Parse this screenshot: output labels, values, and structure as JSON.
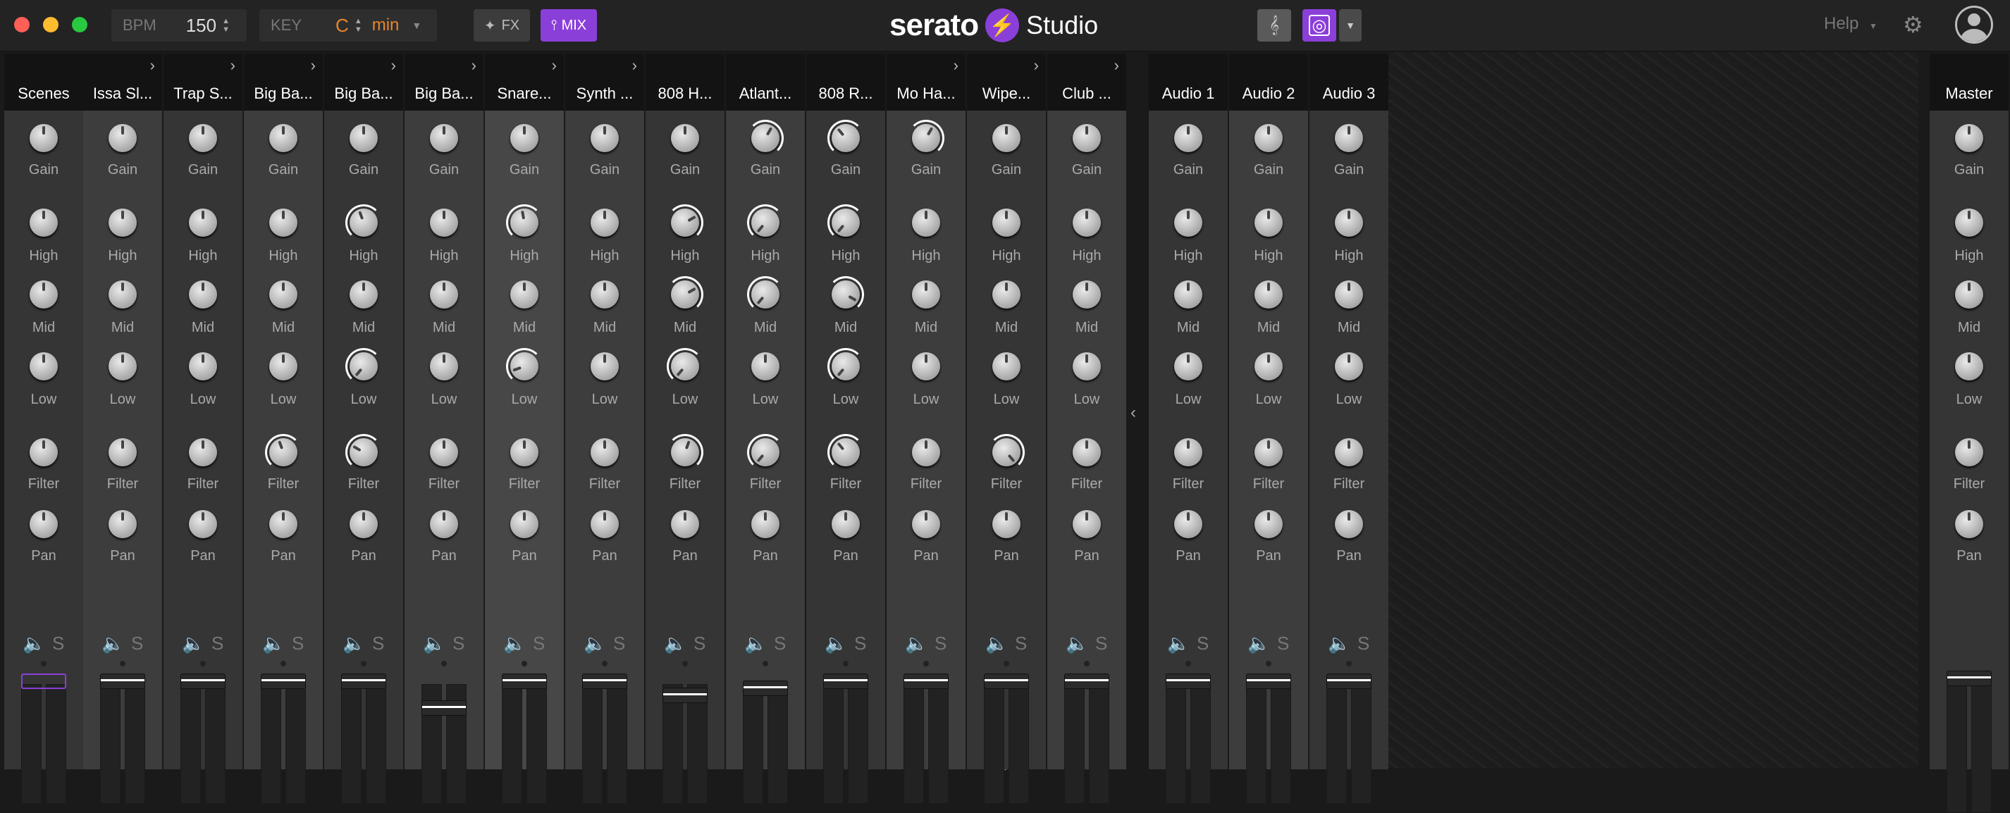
{
  "window": {
    "traffic_lights": [
      "#fe5f57",
      "#febc2e",
      "#28c840"
    ]
  },
  "toolbar": {
    "bpm_label": "BPM",
    "bpm_value": "150",
    "key_label": "KEY",
    "key_value": "C",
    "key_mode": "min",
    "fx_label": "FX",
    "mix_label": "MIX",
    "brand": "serato",
    "product": "Studio",
    "help_label": "Help",
    "accent": "#8b3fd9",
    "key_color": "#e8862c"
  },
  "knob_labels": [
    "Gain",
    "High",
    "Mid",
    "Low",
    "Filter",
    "Pan"
  ],
  "channel_icons": {
    "mute": "speaker-icon",
    "solo": "S"
  },
  "channels": [
    {
      "name": "Scenes",
      "chevron": false,
      "highlight": false
    },
    {
      "name": "Issa Sl...",
      "chevron": true,
      "highlight": false
    },
    {
      "name": "Trap S...",
      "chevron": true,
      "highlight": false
    },
    {
      "name": "Big Ba...",
      "chevron": true,
      "highlight": false
    },
    {
      "name": "Big Ba...",
      "chevron": true,
      "highlight": false
    },
    {
      "name": "Big Ba...",
      "chevron": true,
      "highlight": false
    },
    {
      "name": "Snare...",
      "chevron": true,
      "highlight": true
    },
    {
      "name": "Synth ...",
      "chevron": true,
      "highlight": false
    },
    {
      "name": "808 H...",
      "chevron": false,
      "highlight": false
    },
    {
      "name": "Atlant...",
      "chevron": false,
      "highlight": false
    },
    {
      "name": "808 R...",
      "chevron": false,
      "highlight": false
    },
    {
      "name": "Mo Ha...",
      "chevron": true,
      "highlight": false
    },
    {
      "name": "Wipe...",
      "chevron": true,
      "highlight": false
    },
    {
      "name": "Club ...",
      "chevron": true,
      "highlight": false
    },
    {
      "name": "Audio 1",
      "chevron": false,
      "highlight": false
    },
    {
      "name": "Audio 2",
      "chevron": false,
      "highlight": false
    },
    {
      "name": "Audio 3",
      "chevron": false,
      "highlight": false
    }
  ],
  "master": {
    "name": "Master"
  }
}
